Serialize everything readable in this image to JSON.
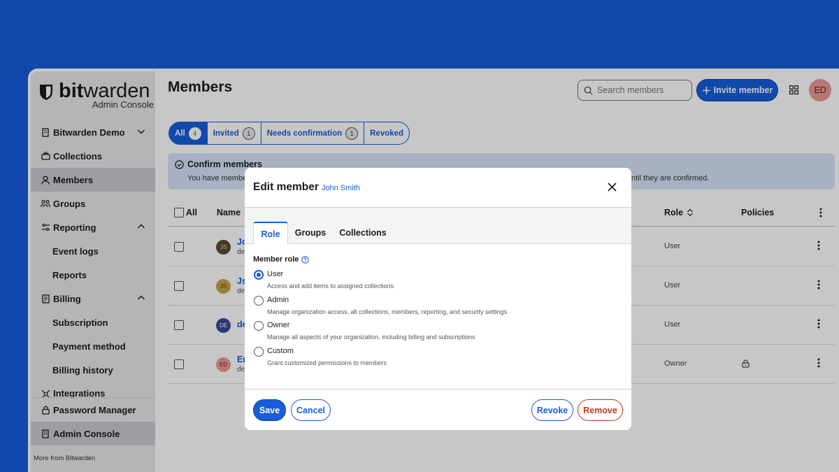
{
  "brand": {
    "word_bold": "bit",
    "word_rest": "warden",
    "subtitle": "Admin Console"
  },
  "sidebar": {
    "items": [
      {
        "label": "Bitwarden Demo",
        "icon": "building-icon"
      },
      {
        "label": "Collections",
        "icon": "collections-icon"
      },
      {
        "label": "Members",
        "icon": "user-icon"
      },
      {
        "label": "Groups",
        "icon": "groups-icon"
      },
      {
        "label": "Reporting",
        "icon": "sliders-icon"
      },
      {
        "label": "Event logs"
      },
      {
        "label": "Reports"
      },
      {
        "label": "Billing",
        "icon": "billing-icon"
      },
      {
        "label": "Subscription"
      },
      {
        "label": "Payment method"
      },
      {
        "label": "Billing history"
      },
      {
        "label": "Integrations",
        "icon": "integrations-icon"
      }
    ],
    "bottom": [
      {
        "label": "Password Manager",
        "icon": "lock-icon"
      },
      {
        "label": "Admin Console",
        "icon": "building-icon"
      }
    ],
    "more": "More from Bitwarden"
  },
  "header": {
    "title": "Members",
    "search_placeholder": "Search members",
    "invite_label": "Invite member",
    "avatar_initials": "ED"
  },
  "filters": [
    {
      "label": "All",
      "count": "4"
    },
    {
      "label": "Invited",
      "count": "1"
    },
    {
      "label": "Needs confirmation",
      "count": "1"
    },
    {
      "label": "Revoked"
    }
  ],
  "callout": {
    "title": "Confirm members",
    "text_left": "You have member",
    "text_right": "ntil they are confirmed."
  },
  "table": {
    "headers": {
      "all": "All",
      "name": "Name",
      "role": "Role",
      "policies": "Policies"
    },
    "rows": [
      {
        "initials": "JS",
        "name": "Jo",
        "email": "de",
        "role": "User",
        "avatar_color": "#5a4a32",
        "avatar_text": "#e8d9b0"
      },
      {
        "initials": "JS",
        "name": "Js",
        "email": "de",
        "role": "User",
        "avatar_color": "#c9a24a",
        "avatar_text": "#5a3f05"
      },
      {
        "initials": "DE",
        "name": "de",
        "email": "",
        "role": "User",
        "avatar_color": "#3c4a98",
        "avatar_text": "#ffffff"
      },
      {
        "initials": "ED",
        "name": "Er",
        "email": "de",
        "role": "Owner",
        "avatar_color": "#e69b95",
        "avatar_text": "#7a1b16"
      }
    ]
  },
  "modal": {
    "title": "Edit member",
    "subtitle": "John Smith",
    "tabs": [
      "Role",
      "Groups",
      "Collections"
    ],
    "role_label": "Member role",
    "options": [
      {
        "label": "User",
        "hint": "Access and add items to assigned collections",
        "selected": true
      },
      {
        "label": "Admin",
        "hint": "Manage organization access, all collections, members, reporting, and security settings",
        "selected": false
      },
      {
        "label": "Owner",
        "hint": "Manage all aspects of your organization, including billing and subscriptions",
        "selected": false
      },
      {
        "label": "Custom",
        "hint": "Grant customized permissions to members",
        "selected": false
      }
    ],
    "buttons": {
      "save": "Save",
      "cancel": "Cancel",
      "revoke": "Revoke",
      "remove": "Remove"
    }
  },
  "colors": {
    "brand_blue": "#175ddc",
    "danger": "#c83522",
    "background": "#175ddc"
  }
}
